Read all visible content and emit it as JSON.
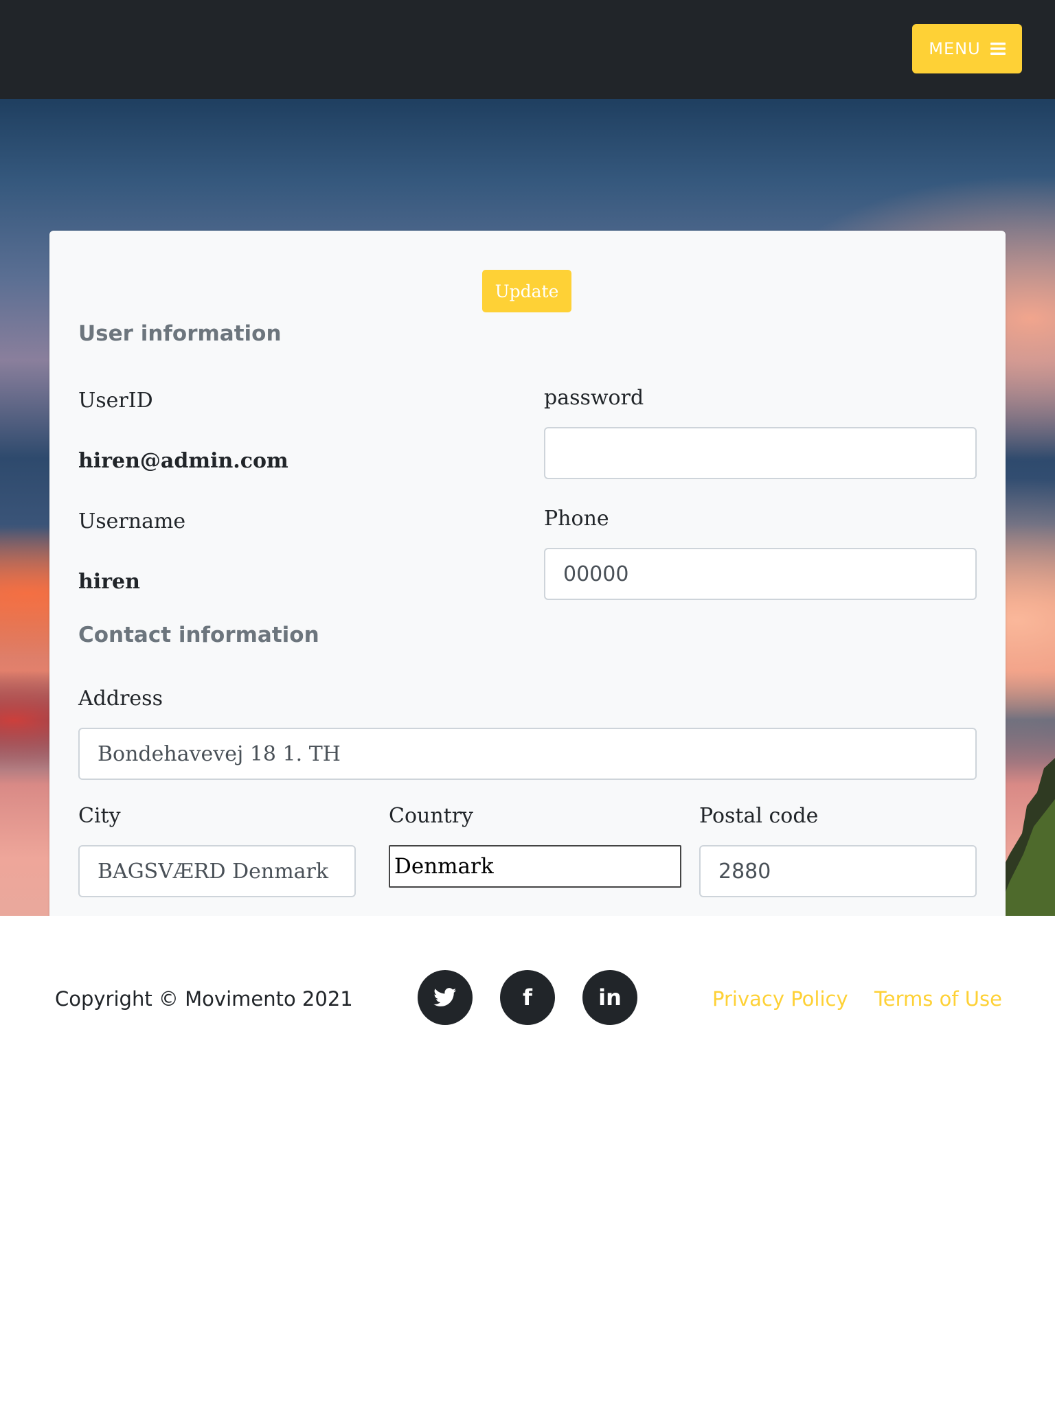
{
  "header": {
    "menu_label": "MENU",
    "menu_icon": "hamburger-icon"
  },
  "colors": {
    "navbar": "#212529",
    "accent": "#fed136",
    "card": "#f8f9fa",
    "section_title": "#6c757d"
  },
  "form": {
    "update_label": "Update",
    "user_section": {
      "title": "User information",
      "userid_label": "UserID",
      "userid_value": "hiren@admin.com",
      "username_label": "Username",
      "username_value": "hiren",
      "password_label": "password",
      "password_value": "",
      "phone_label": "Phone",
      "phone_value": "00000"
    },
    "contact_section": {
      "title": "Contact information",
      "address_label": "Address",
      "address_value": "Bondehavevej 18 1. TH",
      "city_label": "City",
      "city_value": "BAGSVÆRD Denmark",
      "country_label": "Country",
      "country_selected": "Denmark",
      "postal_label": "Postal code",
      "postal_value": "2880"
    }
  },
  "footer": {
    "copyright": "Copyright © Movimento 2021",
    "social": [
      {
        "icon": "twitter-icon",
        "glyph": "t"
      },
      {
        "icon": "facebook-icon",
        "glyph": "f"
      },
      {
        "icon": "linkedin-icon",
        "glyph": "in"
      }
    ],
    "links": {
      "privacy": "Privacy Policy",
      "terms": "Terms of Use"
    }
  }
}
